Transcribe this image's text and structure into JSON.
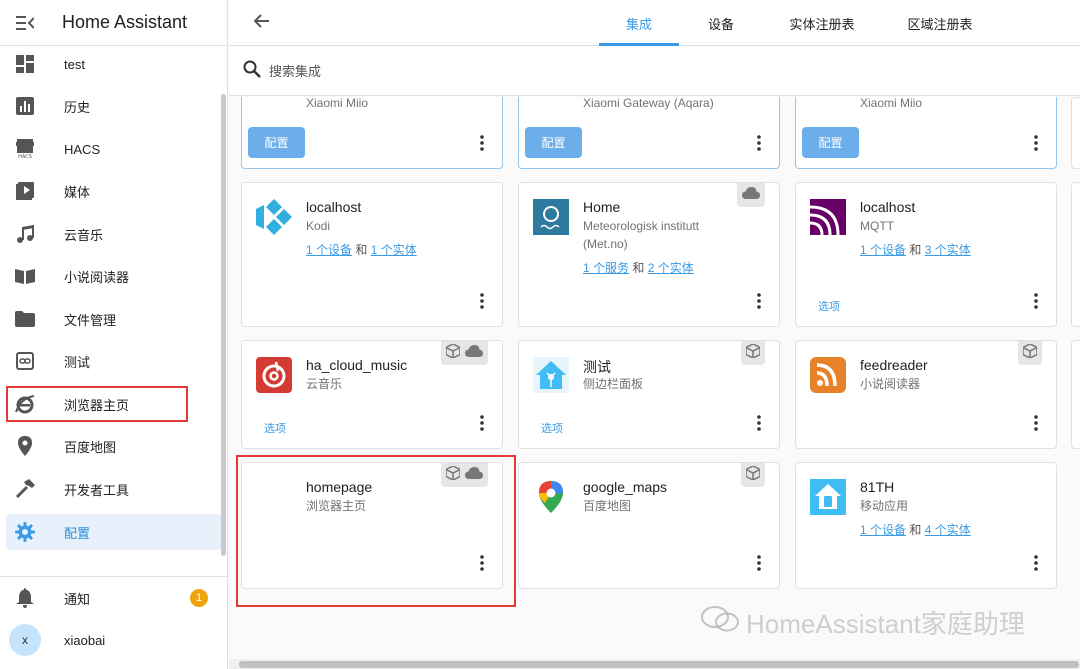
{
  "app": {
    "title": "Home Assistant"
  },
  "sidebar": {
    "items": [
      {
        "label": "test",
        "icon": "dashboard-icon"
      },
      {
        "label": "历史",
        "icon": "chart-box-icon"
      },
      {
        "label": "HACS",
        "icon": "hacs-store-icon"
      },
      {
        "label": "媒体",
        "icon": "play-box-icon"
      },
      {
        "label": "云音乐",
        "icon": "music-note-icon"
      },
      {
        "label": "小说阅读器",
        "icon": "book-open-icon"
      },
      {
        "label": "文件管理",
        "icon": "folder-icon"
      },
      {
        "label": "测试",
        "icon": "link-box-icon"
      },
      {
        "label": "浏览器主页",
        "icon": "internet-explorer-icon"
      },
      {
        "label": "百度地图",
        "icon": "map-marker-icon"
      },
      {
        "label": "开发者工具",
        "icon": "hammer-icon"
      },
      {
        "label": "配置",
        "icon": "gear-icon",
        "active": true
      }
    ],
    "notifications": {
      "label": "通知",
      "count": "1"
    },
    "user": {
      "initial": "x",
      "name": "xiaobai"
    }
  },
  "tabs": [
    {
      "label": "集成",
      "active": true
    },
    {
      "label": "设备"
    },
    {
      "label": "实体注册表"
    },
    {
      "label": "区域注册表"
    }
  ],
  "search": {
    "placeholder": "搜索集成"
  },
  "top_cards": [
    {
      "subtitle": "Xiaomi Miio",
      "button": "配置"
    },
    {
      "subtitle": "Xiaomi Gateway (Aqara)",
      "button": "配置"
    },
    {
      "subtitle": "Xiaomi Miio",
      "button": "配置"
    }
  ],
  "cards": [
    {
      "title": "localhost",
      "subtitle": "Kodi",
      "link1": "1 个设备",
      "and": "和",
      "link2": "1 个实体"
    },
    {
      "title": "Home",
      "subtitle": "Meteorologisk institutt",
      "subtitle2": "(Met.no)",
      "link1": "1 个服务",
      "and": "和",
      "link2": "2 个实体",
      "badges": [
        "cloud-icon"
      ]
    },
    {
      "title": "localhost",
      "subtitle": "MQTT",
      "link1": "1 个设备",
      "and": "和",
      "link2": "3 个实体",
      "option": "选项"
    },
    {
      "title": "ha_cloud_music",
      "subtitle": "云音乐",
      "option": "选项",
      "badges": [
        "package-icon",
        "cloud-icon"
      ]
    },
    {
      "title": "测试",
      "subtitle": "侧边栏面板",
      "option": "选项",
      "badges": [
        "package-icon"
      ]
    },
    {
      "title": "feedreader",
      "subtitle": "小说阅读器",
      "badges": [
        "package-icon"
      ]
    },
    {
      "title": "homepage",
      "subtitle": "浏览器主页",
      "badges": [
        "package-icon",
        "cloud-icon"
      ]
    },
    {
      "title": "google_maps",
      "subtitle": "百度地图",
      "badges": [
        "package-icon"
      ]
    },
    {
      "title": "81TH",
      "subtitle": "移动应用",
      "link1": "1 个设备",
      "and": "和",
      "link2": "4 个实体"
    }
  ],
  "watermark": "HomeAssistant家庭助理",
  "colors": {
    "accent": "#3a9be5",
    "highlight": "#e53935",
    "badge": "#f0a30a"
  }
}
